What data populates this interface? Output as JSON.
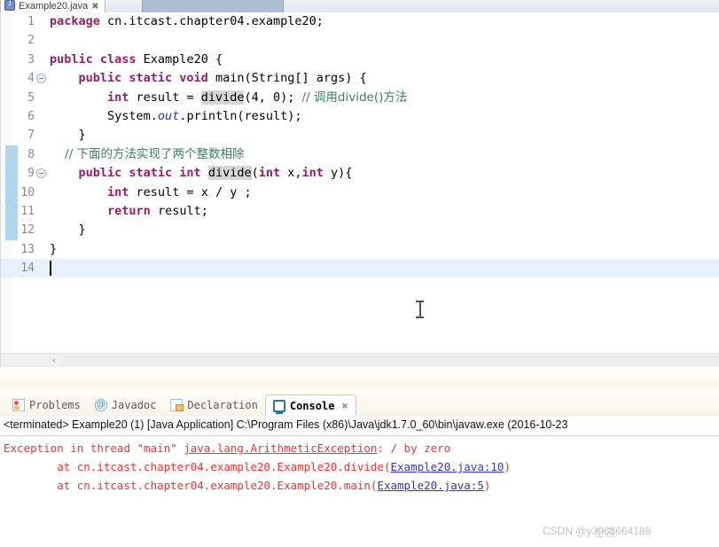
{
  "editor": {
    "tab": {
      "label": "Example20.java",
      "close": "✖",
      "icon": "java-file-icon"
    },
    "current_line": 14,
    "changebar_lines": [
      8,
      9,
      10,
      11,
      12
    ],
    "lines": [
      {
        "no": "1",
        "fold": false,
        "segments": [
          {
            "t": "package ",
            "c": "kw"
          },
          {
            "t": "cn.itcast.chapter04.example20;",
            "c": "cn"
          }
        ]
      },
      {
        "no": "2",
        "fold": false,
        "segments": [
          {
            "t": "",
            "c": "cn"
          }
        ]
      },
      {
        "no": "3",
        "fold": false,
        "segments": [
          {
            "t": "public class ",
            "c": "kw"
          },
          {
            "t": "Example20 {",
            "c": "cn"
          }
        ]
      },
      {
        "no": "4",
        "fold": true,
        "segments": [
          {
            "t": "    ",
            "c": "cn"
          },
          {
            "t": "public static void ",
            "c": "kw"
          },
          {
            "t": "main(String[] args) {",
            "c": "cn"
          }
        ]
      },
      {
        "no": "5",
        "fold": false,
        "segments": [
          {
            "t": "        ",
            "c": "cn"
          },
          {
            "t": "int",
            "c": "kw"
          },
          {
            "t": " result = ",
            "c": "cn"
          },
          {
            "t": "divide",
            "c": "occ"
          },
          {
            "t": "(4, 0); ",
            "c": "cn"
          },
          {
            "t": "// 调用divide()方法",
            "c": "cmt"
          }
        ]
      },
      {
        "no": "6",
        "fold": false,
        "segments": [
          {
            "t": "        System.",
            "c": "cn"
          },
          {
            "t": "out",
            "c": "fld"
          },
          {
            "t": ".println(result);",
            "c": "cn"
          }
        ]
      },
      {
        "no": "7",
        "fold": false,
        "segments": [
          {
            "t": "    }",
            "c": "cn"
          }
        ]
      },
      {
        "no": "8",
        "fold": false,
        "segments": [
          {
            "t": "    // 下面的方法实现了两个整数相除",
            "c": "cmt"
          }
        ]
      },
      {
        "no": "9",
        "fold": true,
        "segments": [
          {
            "t": "    ",
            "c": "cn"
          },
          {
            "t": "public static int ",
            "c": "kw"
          },
          {
            "t": "divide",
            "c": "occ"
          },
          {
            "t": "(",
            "c": "cn"
          },
          {
            "t": "int",
            "c": "kw"
          },
          {
            "t": " x,",
            "c": "cn"
          },
          {
            "t": "int",
            "c": "kw"
          },
          {
            "t": " y){",
            "c": "cn"
          }
        ]
      },
      {
        "no": "10",
        "fold": false,
        "segments": [
          {
            "t": "        ",
            "c": "cn"
          },
          {
            "t": "int",
            "c": "kw"
          },
          {
            "t": " result = x / y ;",
            "c": "cn"
          }
        ]
      },
      {
        "no": "11",
        "fold": false,
        "segments": [
          {
            "t": "        ",
            "c": "cn"
          },
          {
            "t": "return",
            "c": "kw"
          },
          {
            "t": " result;",
            "c": "cn"
          }
        ]
      },
      {
        "no": "12",
        "fold": false,
        "segments": [
          {
            "t": "    }",
            "c": "cn"
          }
        ]
      },
      {
        "no": "13",
        "fold": false,
        "segments": [
          {
            "t": "}",
            "c": "cn"
          }
        ]
      },
      {
        "no": "14",
        "fold": false,
        "segments": [
          {
            "t": "",
            "c": "cn"
          }
        ]
      }
    ],
    "hscroll": {
      "left_arrow": "‹"
    }
  },
  "bottom_view": {
    "tabs": [
      {
        "label": "Problems",
        "icon": "problems-icon",
        "active": false,
        "closable": false
      },
      {
        "label": "Javadoc",
        "icon": "javadoc-icon",
        "active": false,
        "closable": false
      },
      {
        "label": "Declaration",
        "icon": "declaration-icon",
        "active": false,
        "closable": false
      },
      {
        "label": "Console",
        "icon": "console-icon",
        "active": true,
        "closable": true
      }
    ],
    "close_glyph": "✖",
    "console": {
      "header": "<terminated> Example20 (1) [Java Application] C:\\Program Files (x86)\\Java\\jdk1.7.0_60\\bin\\javaw.exe (2016-10-23",
      "lines": [
        {
          "segments": [
            {
              "t": "Exception in thread \"main\" ",
              "c": "err"
            },
            {
              "t": "java.lang.ArithmeticException",
              "c": "errlink"
            },
            {
              "t": ": / by zero",
              "c": "err"
            }
          ]
        },
        {
          "segments": [
            {
              "t": "        at cn.itcast.chapter04.example20.Example20.divide(",
              "c": "err"
            },
            {
              "t": "Example20.java:10",
              "c": "bluelink"
            },
            {
              "t": ")",
              "c": "err"
            }
          ]
        },
        {
          "segments": [
            {
              "t": "        at cn.itcast.chapter04.example20.Example20.main(",
              "c": "err"
            },
            {
              "t": "Example20.java:5",
              "c": "bluelink"
            },
            {
              "t": ")",
              "c": "err"
            }
          ]
        }
      ]
    }
  },
  "watermark": {
    "text": "CSDN @y3068664188",
    "overlay": "全名"
  },
  "colors": {
    "keyword": "#9b1b6b",
    "comment": "#3f7f5f",
    "field": "#2a31c8",
    "error": "#ff2d2d",
    "link": "#3333cc",
    "current_line": "#e8f1fb",
    "changebar": "#9cc8ee"
  }
}
